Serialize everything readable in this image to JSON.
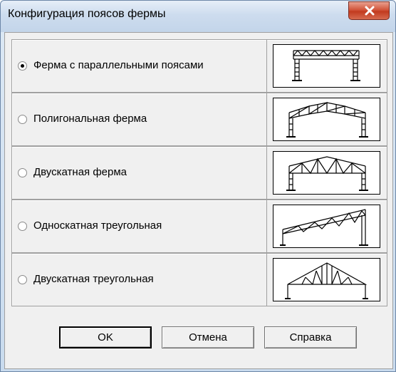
{
  "window": {
    "title": "Конфигурация поясов фермы",
    "close_label": "x"
  },
  "options": [
    {
      "label": "Ферма с параллельными поясами",
      "selected": true,
      "preview_icon": "parallel-chord-truss-icon"
    },
    {
      "label": "Полигональная ферма",
      "selected": false,
      "preview_icon": "polygonal-truss-icon"
    },
    {
      "label": "Двускатная ферма",
      "selected": false,
      "preview_icon": "gable-truss-icon"
    },
    {
      "label": "Односкатная треугольная",
      "selected": false,
      "preview_icon": "mono-pitch-triangular-truss-icon"
    },
    {
      "label": "Двускатная треугольная",
      "selected": false,
      "preview_icon": "gable-triangular-truss-icon"
    }
  ],
  "buttons": {
    "ok": "OK",
    "cancel": "Отмена",
    "help": "Справка"
  }
}
